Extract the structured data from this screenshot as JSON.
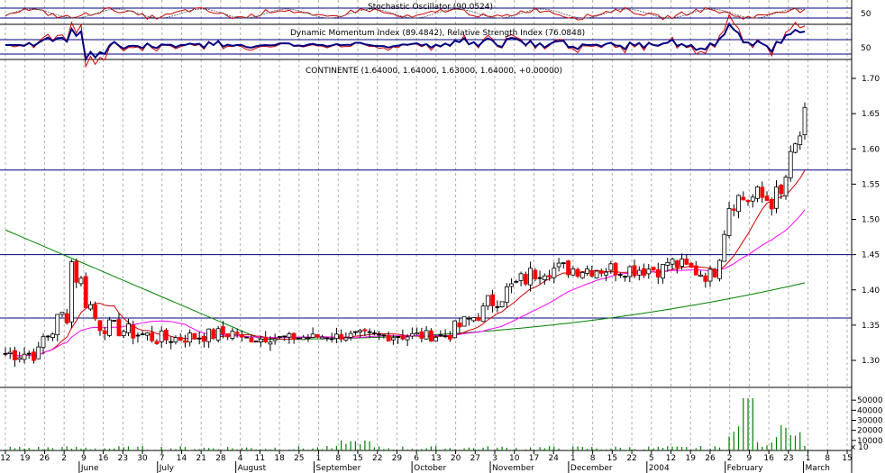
{
  "title_stochastic": "Stochastic Oscillator (90.0524)",
  "title_momentum": "Dynamic Momentum Index (89.4842), Relative Strength Index (76.0848)",
  "title_price": "CONTINENTE (1.64000, 1.64000, 1.63000, 1.64000, +0.00000)",
  "stoch_tick": "50",
  "momentum_tick": "50",
  "volume_unit": "x 10",
  "colors": {
    "up": "#ffffff",
    "down": "#ff0000",
    "doji": "#000000",
    "ma_short": "#cc0000",
    "ma_mid": "#ff00ff",
    "ma_long": "#008000",
    "lt_trend": "#008000",
    "h_lines": "#000080",
    "volume": "#008000",
    "rsi": "#cc0000",
    "dmi": "#000080"
  },
  "chart_data": [
    {
      "type": "candlestick",
      "title": "CONTINENTE (1.64000, 1.64000, 1.63000, 1.64000, +0.00000)",
      "ylim": [
        1.28,
        1.72
      ],
      "y_ticks": [
        "1.70",
        "1.65",
        "1.60",
        "1.55",
        "1.50",
        "1.45",
        "1.40",
        "1.35",
        "1.30"
      ],
      "x_tick_labels": [
        "12",
        "19",
        "26",
        "2",
        "9",
        "16",
        "23",
        "30",
        "7",
        "14",
        "21",
        "28",
        "4",
        "11",
        "18",
        "25",
        "1",
        "8",
        "15",
        "22",
        "29",
        "6",
        "13",
        "20",
        "27",
        "3",
        "10",
        "17",
        "24",
        "1",
        "8",
        "15",
        "22",
        "5",
        "12",
        "19",
        "26",
        "2",
        "9",
        "16",
        "23",
        "1",
        "8",
        "15"
      ],
      "month_labels": [
        "June",
        "July",
        "August",
        "September",
        "October",
        "November",
        "December",
        "2004",
        "February",
        "March"
      ],
      "horizontal_levels": [
        1.57,
        1.45,
        1.36
      ],
      "long_trend_line": {
        "from": 1.485,
        "to": 1.33
      },
      "moving_average_end_values": {
        "short": 1.515,
        "mid": 1.46,
        "long": 1.41
      },
      "segments": [
        {
          "bars": 8,
          "from": 1.31,
          "to": 1.31,
          "noise": 0.012
        },
        {
          "bars": 6,
          "from": 1.33,
          "to": 1.37,
          "noise": 0.02
        },
        {
          "bars": 6,
          "from": 1.44,
          "to": 1.36,
          "noise": 0.025
        },
        {
          "bars": 14,
          "from": 1.35,
          "to": 1.33,
          "noise": 0.012
        },
        {
          "bars": 16,
          "from": 1.33,
          "to": 1.34,
          "noise": 0.01
        },
        {
          "bars": 24,
          "from": 1.33,
          "to": 1.335,
          "noise": 0.006
        },
        {
          "bars": 20,
          "from": 1.335,
          "to": 1.335,
          "noise": 0.008
        },
        {
          "bars": 8,
          "from": 1.34,
          "to": 1.37,
          "noise": 0.012
        },
        {
          "bars": 12,
          "from": 1.38,
          "to": 1.43,
          "noise": 0.015
        },
        {
          "bars": 26,
          "from": 1.43,
          "to": 1.43,
          "noise": 0.012
        },
        {
          "bars": 10,
          "from": 1.44,
          "to": 1.42,
          "noise": 0.012
        },
        {
          "bars": 5,
          "from": 1.46,
          "to": 1.56,
          "noise": 0.05
        },
        {
          "bars": 10,
          "from": 1.53,
          "to": 1.53,
          "noise": 0.02
        },
        {
          "bars": 5,
          "from": 1.56,
          "to": 1.64,
          "noise": 0.02
        }
      ]
    },
    {
      "type": "bar",
      "title": "Volume",
      "y_ticks": [
        "50000",
        "40000",
        "30000",
        "20000",
        "10000"
      ],
      "ylim": [
        0,
        60000
      ]
    }
  ]
}
